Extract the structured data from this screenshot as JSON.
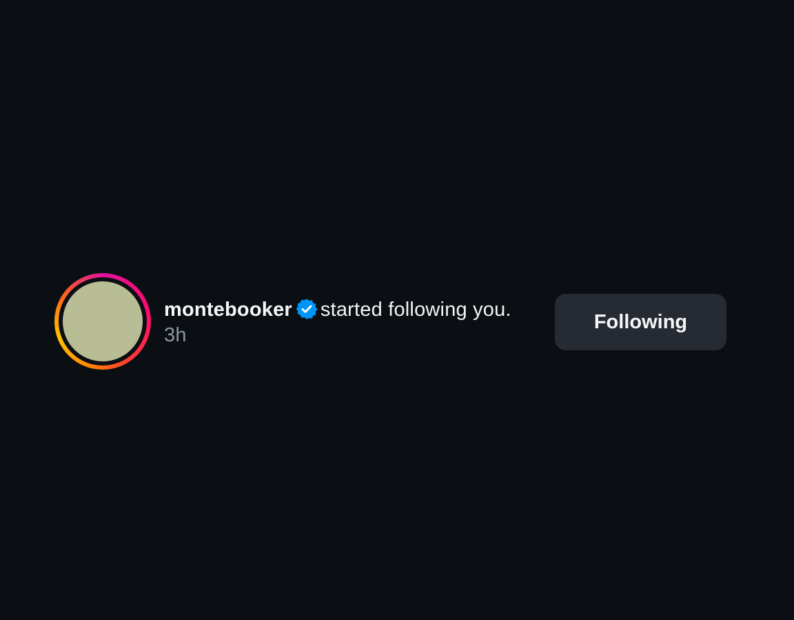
{
  "notification": {
    "username": "montebooker",
    "verified_icon": "verified-badge-icon",
    "action_text": "started following you.",
    "time": "3h",
    "button_label": "Following"
  },
  "colors": {
    "background": "#0b0f13",
    "avatar_fill": "#b8bd95",
    "verified_blue": "#0095f6",
    "button_bg": "#262a32",
    "time_gray": "#8c96a3"
  }
}
